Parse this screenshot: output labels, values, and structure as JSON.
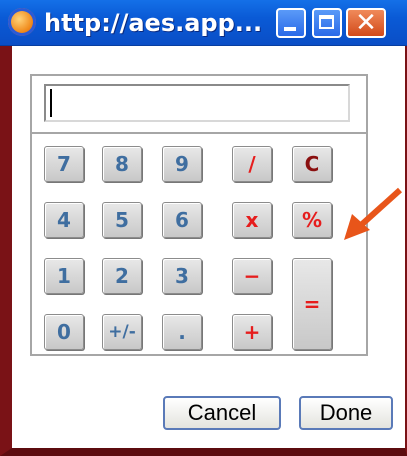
{
  "window": {
    "title": "http://aes.app...",
    "title_icon": "firefox-icon",
    "controls": {
      "minimize": "minimize-icon",
      "maximize": "maximize-icon",
      "close": "✕"
    }
  },
  "calculator": {
    "display_value": "",
    "keys": {
      "k7": "7",
      "k8": "8",
      "k9": "9",
      "divide": "/",
      "clear": "C",
      "k4": "4",
      "k5": "5",
      "k6": "6",
      "multiply": "x",
      "percent": "%",
      "k1": "1",
      "k2": "2",
      "k3": "3",
      "minus": "−",
      "equals": "=",
      "k0": "0",
      "plusminus": "+/-",
      "decimal": ".",
      "plus": "+"
    }
  },
  "annotation": {
    "icon": "red-arrow-icon",
    "color": "#e8551a"
  },
  "dialog": {
    "cancel_label": "Cancel",
    "done_label": "Done"
  },
  "colors": {
    "digit": "#3f6ea0",
    "operator": "#e61d1d",
    "clear": "#8a1010",
    "titlebar": "#0a5ad6"
  }
}
